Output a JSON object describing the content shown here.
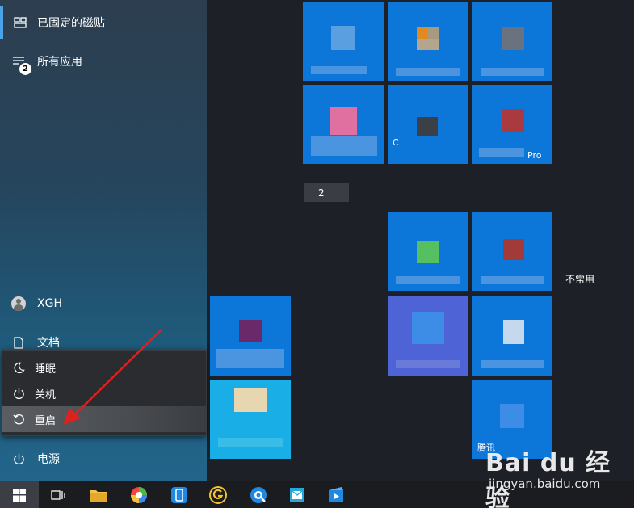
{
  "sidebar": {
    "pinned_tiles": "已固定的磁贴",
    "all_apps": "所有应用",
    "all_apps_badge": "2",
    "user": "XGH",
    "documents": "文档",
    "power": "电源"
  },
  "power_menu": {
    "sleep": "睡眠",
    "shutdown": "关机",
    "restart": "重启"
  },
  "tiles": {
    "group_label": "不常用",
    "tile_pro_caption": "Pro",
    "tile_tencent_caption": "腾讯",
    "tile_c_caption": "C",
    "side_fragment": "2"
  },
  "watermark": {
    "logo": "Bai du 经验",
    "url": "jingyan.baidu.com"
  },
  "colors": {
    "accent": "#0c77d8",
    "arrow": "#e0201f"
  }
}
